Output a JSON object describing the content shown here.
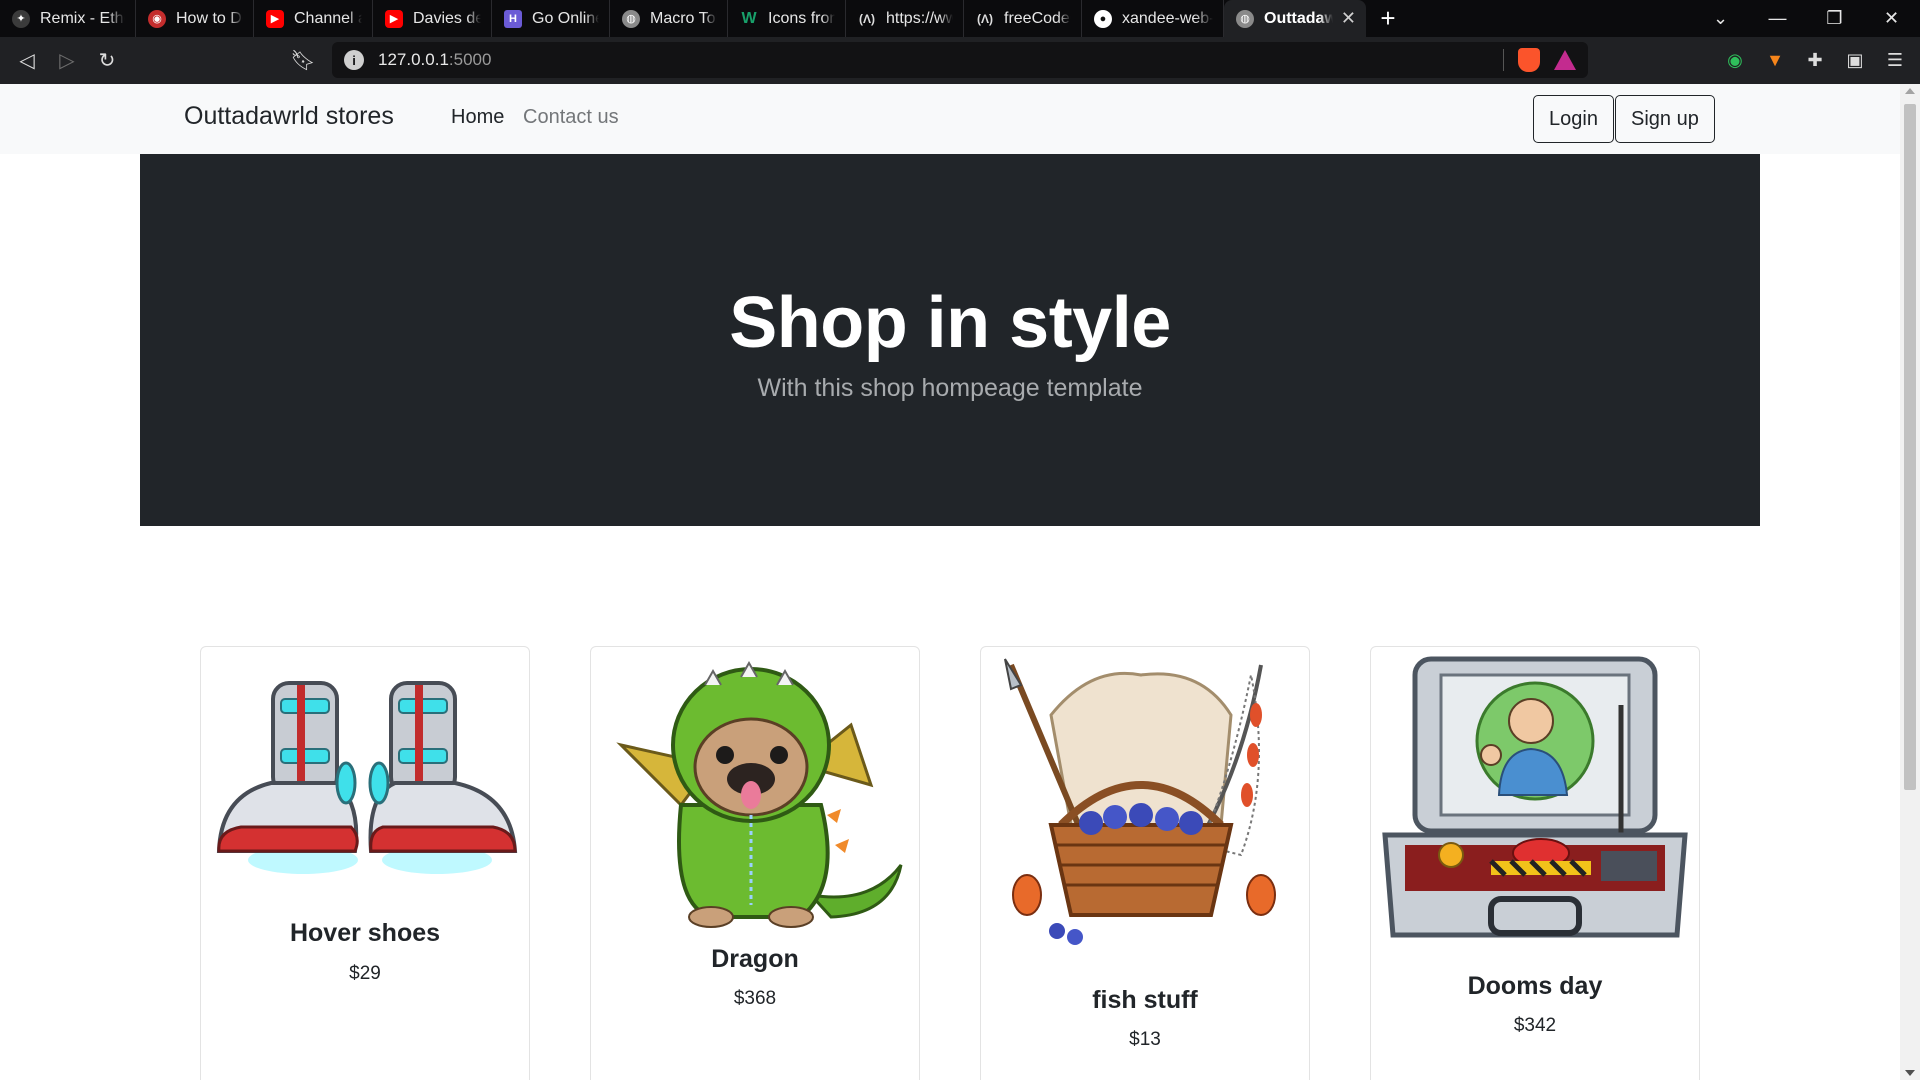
{
  "browser": {
    "tabs": [
      {
        "title": "Remix - Ethereum",
        "icon": "remix-icon",
        "color": "#3b3b3b"
      },
      {
        "title": "How to Deploy",
        "icon": "deploy-icon",
        "color": "#c42d2d"
      },
      {
        "title": "Channel analytics",
        "icon": "youtube-icon",
        "color": "#ff0000"
      },
      {
        "title": "Davies dev - YouTube",
        "icon": "youtube-icon",
        "color": "#ff0000"
      },
      {
        "title": "Go Online With",
        "icon": "brand-icon",
        "color": "#6b5bd6"
      },
      {
        "title": "Macro Token: H",
        "icon": "globe-icon",
        "color": "#8a8a8a"
      },
      {
        "title": "Icons from Font",
        "icon": "w-icon",
        "color": "#18a06a"
      },
      {
        "title": "https://www.fr",
        "icon": "freecodecamp-icon",
        "color": "#222222"
      },
      {
        "title": "freeCodeCamp",
        "icon": "freecodecamp-icon",
        "color": "#222222"
      },
      {
        "title": "xandee-web-p",
        "icon": "github-icon",
        "color": "#222222"
      },
      {
        "title": "Outtadawrld",
        "icon": "globe-icon",
        "color": "#8a8a8a"
      }
    ],
    "active_tab_index": 10,
    "url_host": "127.0.0.1",
    "url_port": ":5000"
  },
  "site": {
    "brand": "Outtadawrld stores",
    "nav": {
      "home": "Home",
      "contact": "Contact us"
    },
    "auth": {
      "login": "Login",
      "signup": "Sign up"
    },
    "hero": {
      "title": "Shop in style",
      "subtitle": "With this shop hompeage template"
    },
    "products": [
      {
        "name": "Hover shoes",
        "price": "$29",
        "image": "hover-shoes-image"
      },
      {
        "name": "Dragon",
        "price": "$368",
        "image": "pug-dragon-image"
      },
      {
        "name": "fish stuff",
        "price": "$13",
        "image": "fish-basket-image"
      },
      {
        "name": "Dooms day",
        "price": "$342",
        "image": "doomsday-case-image"
      }
    ]
  },
  "colors": {
    "hero_bg": "#212529",
    "nav_bg": "#f8f9fa",
    "chrome_bg": "#202124",
    "tabstrip_bg": "#0b0b0d"
  }
}
